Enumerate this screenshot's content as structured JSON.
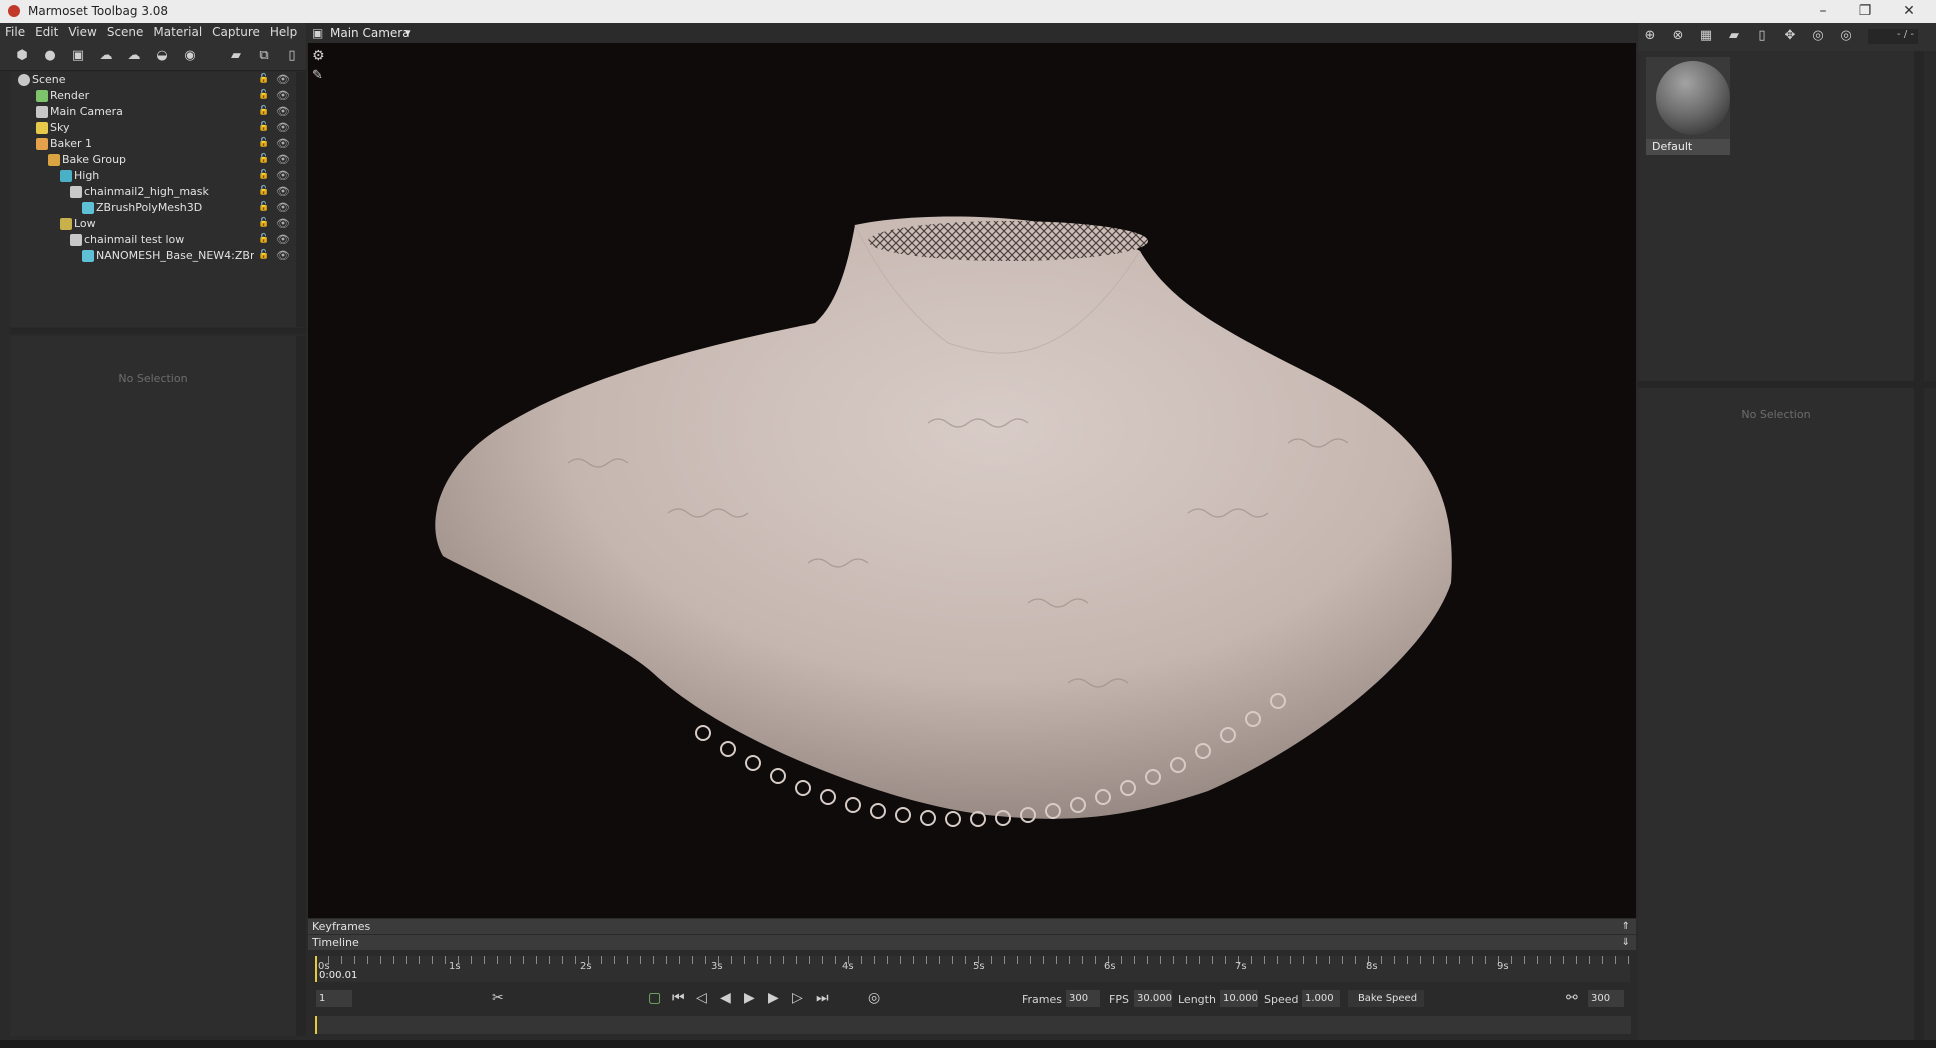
{
  "window": {
    "title": "Marmoset Toolbag 3.08",
    "minimize": "–",
    "restore": "❐",
    "close": "✕"
  },
  "menu": [
    "File",
    "Edit",
    "View",
    "Scene",
    "Material",
    "Capture",
    "Help"
  ],
  "scene_tree": [
    {
      "label": "Scene",
      "icon": "scene-icon",
      "color": "#c8c8c8"
    },
    {
      "label": "Render",
      "icon": "render-icon",
      "color": "#7ec46a"
    },
    {
      "label": "Main Camera",
      "icon": "camera-icon",
      "color": "#c8c8c8"
    },
    {
      "label": "Sky",
      "icon": "sky-icon",
      "color": "#e6c84a"
    },
    {
      "label": "Baker 1",
      "icon": "baker-icon",
      "color": "#e6a24a"
    },
    {
      "label": "Bake Group",
      "icon": "folder-icon",
      "color": "#d9a441"
    },
    {
      "label": "High",
      "icon": "high-icon",
      "color": "#4ab0c8"
    },
    {
      "label": "chainmail2_high_mask",
      "icon": "object-icon",
      "color": "#c8c8c8"
    },
    {
      "label": "ZBrushPolyMesh3D",
      "icon": "mesh-icon",
      "color": "#5fc1d6"
    },
    {
      "label": "Low",
      "icon": "low-icon",
      "color": "#c8b04a"
    },
    {
      "label": "chainmail test low",
      "icon": "object-icon",
      "color": "#c8c8c8"
    },
    {
      "label": "NANOMESH_Base_NEW4:ZBr",
      "icon": "mesh-icon",
      "color": "#5fc1d6"
    }
  ],
  "left_props": {
    "empty_text": "No Selection"
  },
  "viewport": {
    "camera_label": "Main Camera",
    "camera_dropdown": "▾"
  },
  "material": {
    "name": "Default",
    "counter": "- / -"
  },
  "right_props": {
    "empty_text": "No Selection"
  },
  "timeline": {
    "keyframes_label": "Keyframes",
    "timeline_label": "Timeline",
    "current_time": "0:00.01",
    "ticks": [
      "0s",
      "1s",
      "2s",
      "3s",
      "4s",
      "5s",
      "6s",
      "7s",
      "8s",
      "9s"
    ],
    "frame_field": "1",
    "frames_label": "Frames",
    "frames_value": "300",
    "fps_label": "FPS",
    "fps_value": "30.000",
    "length_label": "Length",
    "length_value": "10.000",
    "speed_label": "Speed",
    "speed_value": "1.000",
    "bake_speed_label": "Bake Speed",
    "end_frame_value": "300"
  }
}
